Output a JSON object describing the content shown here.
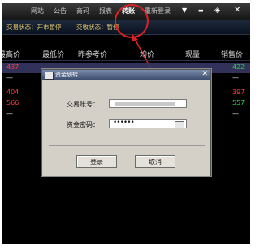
{
  "menu": {
    "items": [
      "网站",
      "公告",
      "商码",
      "报表",
      "转账",
      "重新登录"
    ],
    "active_index": 4
  },
  "window_controls": {
    "pin": "▼",
    "min": "▬",
    "restore": "◈",
    "close": "✕"
  },
  "status": {
    "trade_label": "交易状态：",
    "trade_value": "开市暂停",
    "delivery_label": "交收状态：",
    "delivery_value": "暂停"
  },
  "table": {
    "headers": [
      "最高价",
      "最低价",
      "昨参考价",
      "均价",
      "现量",
      "销售价"
    ],
    "rows": [
      {
        "high": "437",
        "right": "422",
        "high_color": "red",
        "right_color": "green"
      },
      {
        "high": "—",
        "right": "—",
        "high_color": "white",
        "right_color": "white"
      },
      {
        "high": "404",
        "right": "397",
        "high_color": "red",
        "right_color": "red"
      },
      {
        "high": "566",
        "right": "557",
        "high_color": "red",
        "right_color": "green"
      },
      {
        "high": "—",
        "right": "—",
        "high_color": "white",
        "right_color": "white"
      }
    ]
  },
  "dialog": {
    "title": "资金划转",
    "close_glyph": "✕",
    "account_label": "交易账号：",
    "password_label": "资金密码：",
    "password_mask": "••••••",
    "ok_label": "登录",
    "cancel_label": "取消"
  },
  "colors": {
    "highlight": "#e02020",
    "status_text": "#e6c770",
    "up": "#ff3b3b",
    "down": "#29d44a"
  }
}
